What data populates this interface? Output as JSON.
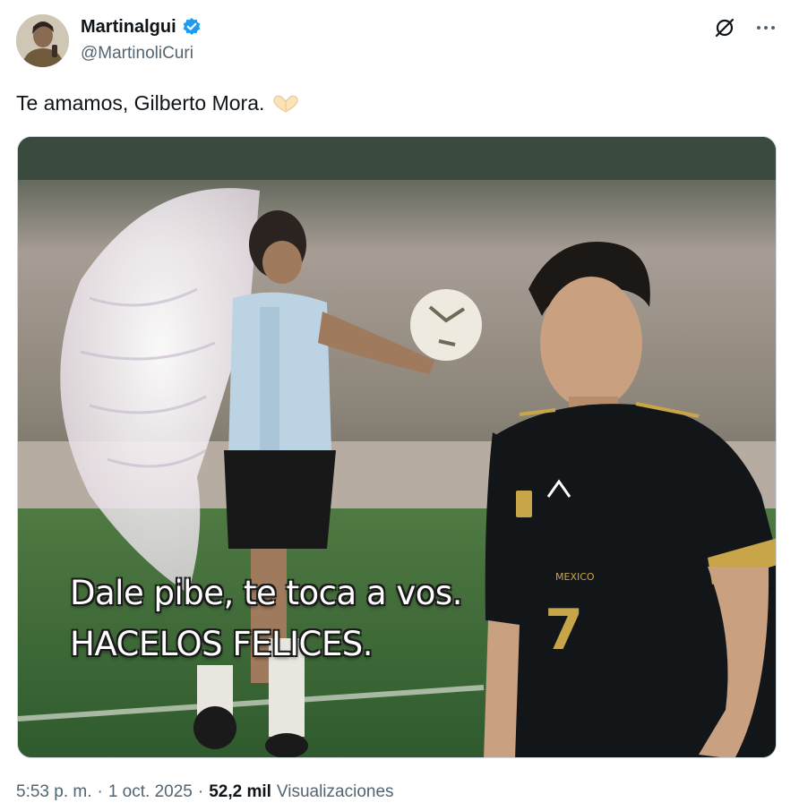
{
  "author": {
    "display_name": "Martinalgui",
    "handle": "@MartinoliCuri",
    "verified": true,
    "avatar_icon": "user-avatar-photo"
  },
  "actions": {
    "grok_icon": "grok-icon",
    "more_icon": "more-horizontal-icon"
  },
  "tweet": {
    "text": "Te amamos, Gilberto Mora."
  },
  "media": {
    "caption_line1": "Dale pibe, te toca a vos.",
    "caption_line2": "HACELOS FELICES."
  },
  "meta": {
    "time": "5:53 p. m.",
    "sep1": "·",
    "date": "1 oct. 2025",
    "sep2": "·",
    "views_count": "52,2 mil",
    "views_label": "Visualizaciones"
  },
  "colors": {
    "verified_blue": "#1d9bf0",
    "secondary_text": "#536471",
    "primary_text": "#0f1419"
  }
}
